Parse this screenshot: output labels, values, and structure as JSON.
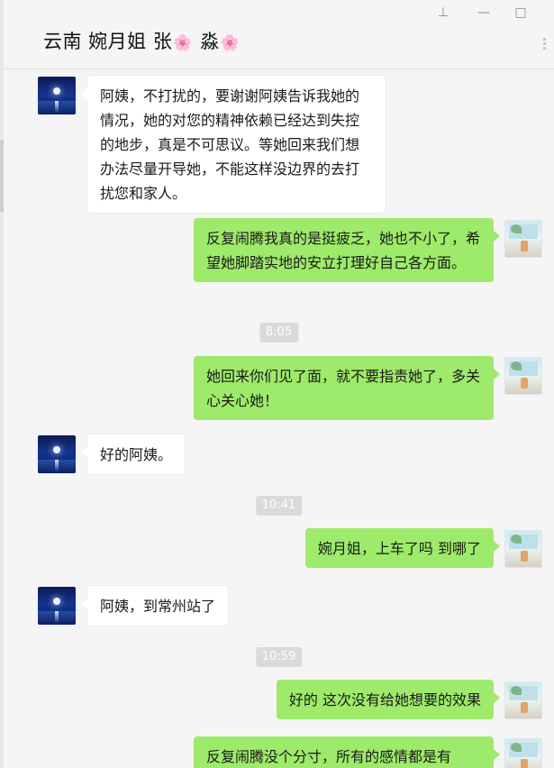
{
  "header": {
    "title_text": "云南 婉月姐 张",
    "title_flower_1": "🌸",
    "title_suffix": " 淼",
    "title_flower_2": "🌸",
    "controls": {
      "pin": "⊥",
      "minimize": "—",
      "maximize": "□"
    }
  },
  "messages": [
    {
      "side": "left",
      "text": "阿姨，不打扰的，要谢谢阿姨告诉我她的情况，她的对您的精神依赖已经达到失控的地步，真是不可思议。等她回来我们想办法尽量开导她，不能这样没边界的去打扰您和家人。"
    },
    {
      "side": "right",
      "text": "反复闹腾我真的是挺疲乏，她也不小了，希望她脚踏实地的安立打理好自己各方面。"
    },
    {
      "time": "8:05"
    },
    {
      "side": "right",
      "text": "她回来你们见了面，就不要指责她了，多关心关心她！"
    },
    {
      "side": "left",
      "text": "好的阿姨。"
    },
    {
      "time": "10:41"
    },
    {
      "side": "right",
      "text": "婉月姐，上车了吗 到哪了"
    },
    {
      "side": "left",
      "text": "阿姨，到常州站了"
    },
    {
      "time": "10:59"
    },
    {
      "side": "right",
      "text": "好的 这次没有给她想要的效果"
    },
    {
      "side": "right",
      "text": "反复闹腾没个分寸，所有的感情都是有"
    }
  ],
  "colors": {
    "right_bubble": "#9eea6a",
    "left_bubble": "#ffffff",
    "background": "#f5f5f5",
    "timestamp_bg": "#dadada"
  }
}
